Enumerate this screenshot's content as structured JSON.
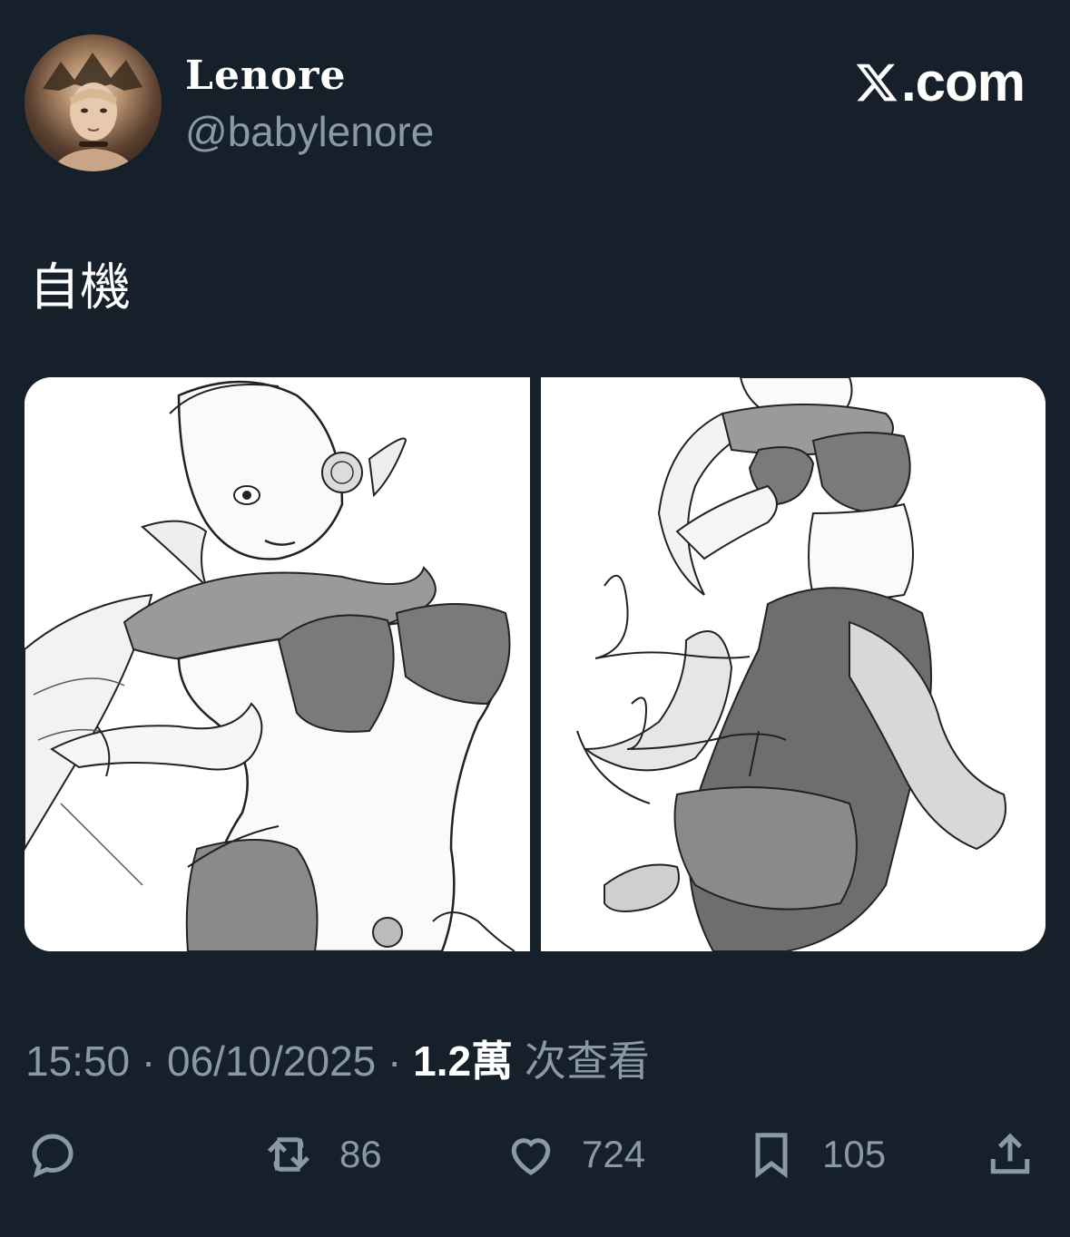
{
  "tweet": {
    "display_name": "Lenore",
    "handle": "@babylenore",
    "brand": ".com",
    "text": "自機",
    "time": "15:50",
    "separator": "·",
    "date": "06/10/2025",
    "views_count": "1.2萬",
    "views_label": "次查看"
  },
  "actions": {
    "retweets": "86",
    "likes": "724",
    "bookmarks": "105"
  },
  "icons": [
    "reply-icon",
    "retweet-icon",
    "like-icon",
    "bookmark-icon",
    "share-icon",
    "x-logo-icon"
  ],
  "colors": {
    "background": "#15202b",
    "text_primary": "#ffffff",
    "text_secondary": "#8b98a5"
  }
}
